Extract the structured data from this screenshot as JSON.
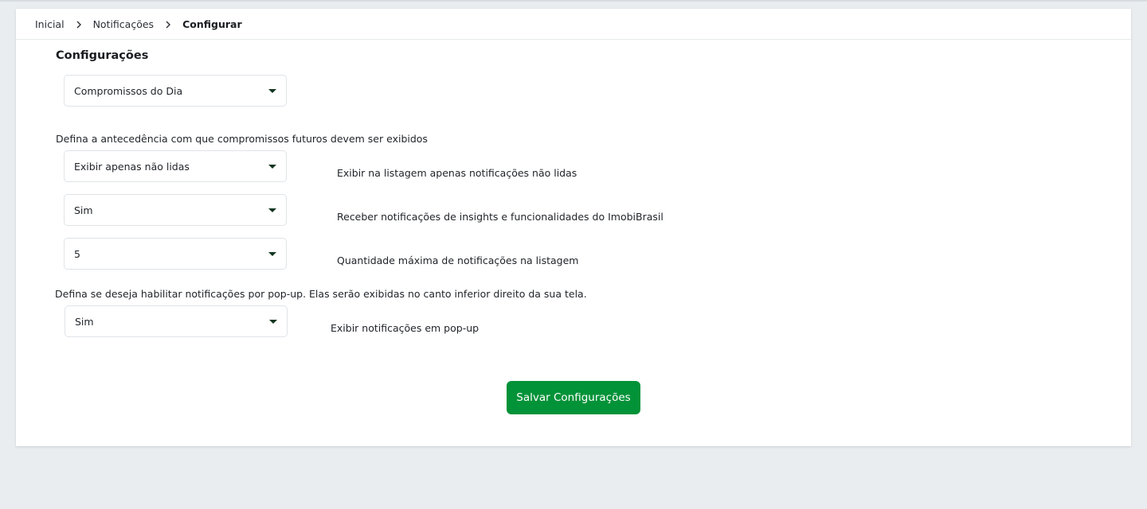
{
  "breadcrumb": {
    "items": [
      "Inicial",
      "Notificações",
      "Configurar"
    ]
  },
  "section_title": "Configurações",
  "fields": {
    "agenda_select": {
      "value": "Compromissos do Dia"
    },
    "agenda_hint": "Defina a antecedência com que compromissos futuros devem ser exibidos",
    "unread_select": {
      "value": "Exibir apenas não lidas",
      "description": "Exibir na listagem apenas notificações não lidas"
    },
    "insights_select": {
      "value": "Sim",
      "description": "Receber notificações de insights e funcionalidades do ImobiBrasil"
    },
    "max_select": {
      "value": "5",
      "description": "Quantidade máxima de notificações na listagem"
    },
    "popup_hint": "Defina se deseja habilitar notificações por pop-up. Elas serão exibidas no canto inferior direito da sua tela.",
    "popup_select": {
      "value": "Sim",
      "description": "Exibir notificações em pop-up"
    }
  },
  "actions": {
    "save_label": "Salvar Configurações"
  },
  "colors": {
    "primary": "#029238",
    "caret": "#12351f",
    "background": "#e9edf0"
  }
}
